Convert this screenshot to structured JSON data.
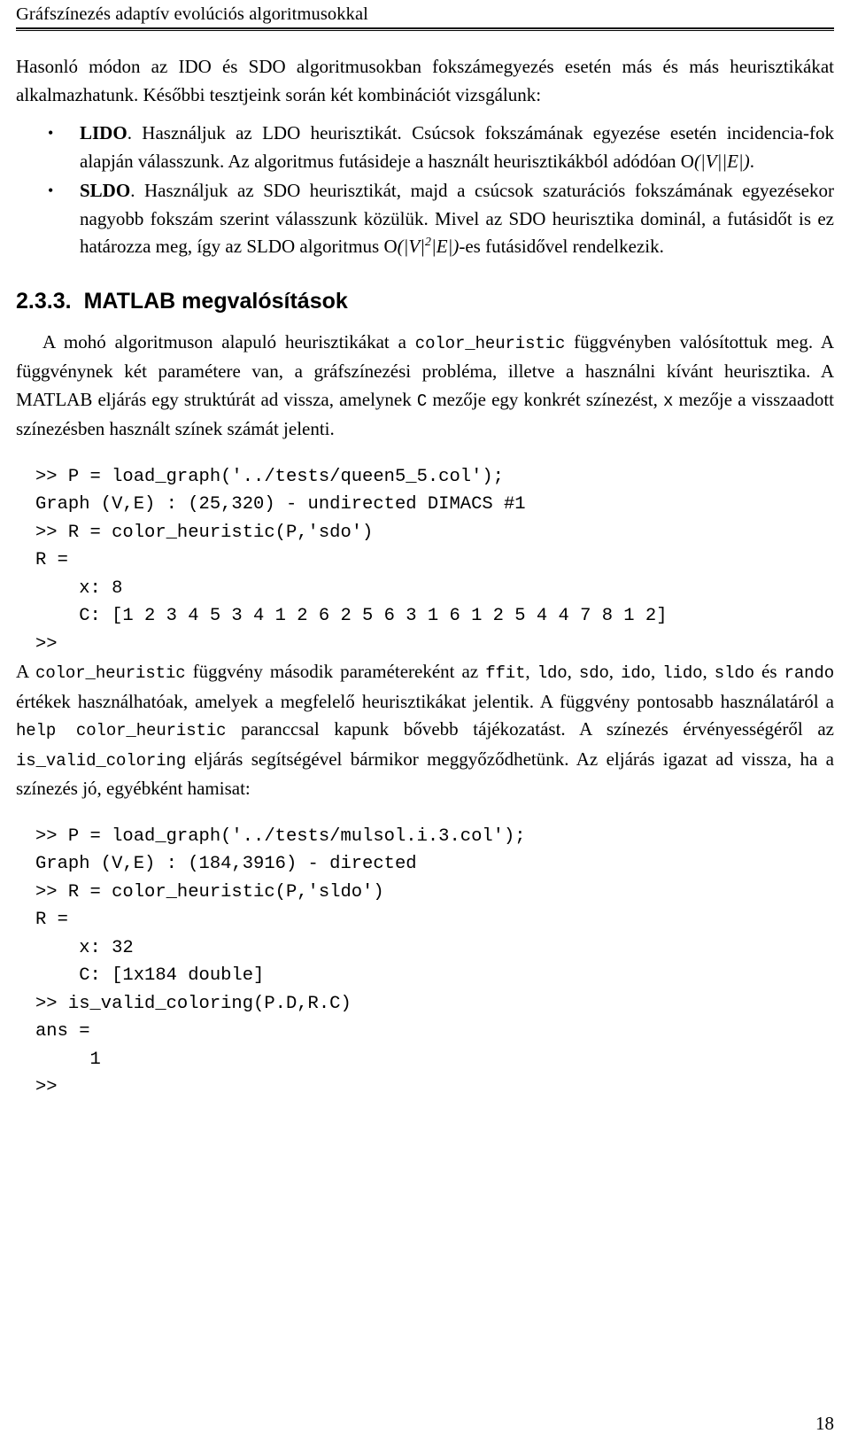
{
  "header": {
    "running_title": "Gráfszínezés adaptív evolúciós algoritmusokkal"
  },
  "intro": {
    "paragraph": "Hasonló módon az IDO és SDO algoritmusokban fokszámegyezés esetén más és más heurisztikákat alkalmazhatunk. Későbbi tesztjeink során két kombinációt vizsgálunk:"
  },
  "bullets": [
    {
      "marker": "•",
      "lead": "LIDO",
      "text_before_math": ". Használjuk az LDO heurisztikát. Csúcsok fokszámának egyezése esetén incidencia-fok alapján válasszunk. Az algoritmus futásideje a használt heurisztikákból adódóan ",
      "math": "O(|V||E|)",
      "text_after_math": "."
    },
    {
      "marker": "•",
      "lead": "SLDO",
      "text_before_math": ". Használjuk az SDO heurisztikát, majd a csúcsok szaturációs fokszámának egyezésekor nagyobb fokszám szerint válasszunk közülük. Mivel az SDO heurisztika dominál, a futásidőt is ez határozza meg, így az SLDO algoritmus ",
      "math": "O(|V|²|E|)",
      "text_after_math": "-es futásidővel rendelkezik."
    }
  ],
  "section": {
    "number": "2.3.3.",
    "title": "MATLAB megvalósítások"
  },
  "paragraph_impl": {
    "p1": "A mohó algoritmuson alapuló heurisztikákat a ",
    "code1": "color_heuristic",
    "p2": " függvényben valósítottuk meg. A függvénynek két paramétere van, a gráfszínezési probléma, illetve a használni kívánt heurisztika. A MATLAB eljárás egy struktúrát ad vissza, amelynek ",
    "code2": "C",
    "p3": " mezője egy konkrét színezést, ",
    "code3": "x",
    "p4": " mezője a visszaadott színezésben használt színek számát jelenti."
  },
  "code_block_1": ">> P = load_graph('../tests/queen5_5.col');\nGraph (V,E) : (25,320) - undirected DIMACS #1\n>> R = color_heuristic(P,'sdo')\nR =\n    x: 8\n    C: [1 2 3 4 5 3 4 1 2 6 2 5 6 3 1 6 1 2 5 4 4 7 8 1 2]\n>>",
  "paragraph_params": {
    "p1": "A ",
    "code1": "color_heuristic",
    "p2": " függvény második paramétereként az ",
    "code2": "ffit",
    "sep1": ", ",
    "code3": "ldo",
    "sep2": ", ",
    "code4": "sdo",
    "sep3": ", ",
    "code5": "ido",
    "sep4": ", ",
    "code6": "lido",
    "sep5": ", ",
    "code7": "sldo",
    "p3": " és ",
    "code8": "rando",
    "p4": " értékek használhatóak, amelyek a megfelelő heurisztikákat jelentik. A függvény pontosabb használatáról a ",
    "code9": "help color_heuristic",
    "p5": " paranccsal kapunk bővebb tájékozatást. A színezés érvényességéről az ",
    "code10": "is_valid_coloring",
    "p6": " eljárás segítségével bármikor meggyőződhetünk. Az eljárás igazat ad vissza, ha a színezés jó, egyébként hamisat:"
  },
  "code_block_2": ">> P = load_graph('../tests/mulsol.i.3.col');\nGraph (V,E) : (184,3916) - directed\n>> R = color_heuristic(P,'sldo')\nR =\n    x: 32\n    C: [1x184 double]\n>> is_valid_coloring(P.D,R.C)\nans =\n     1\n>>",
  "footer": {
    "page_number": "18"
  }
}
